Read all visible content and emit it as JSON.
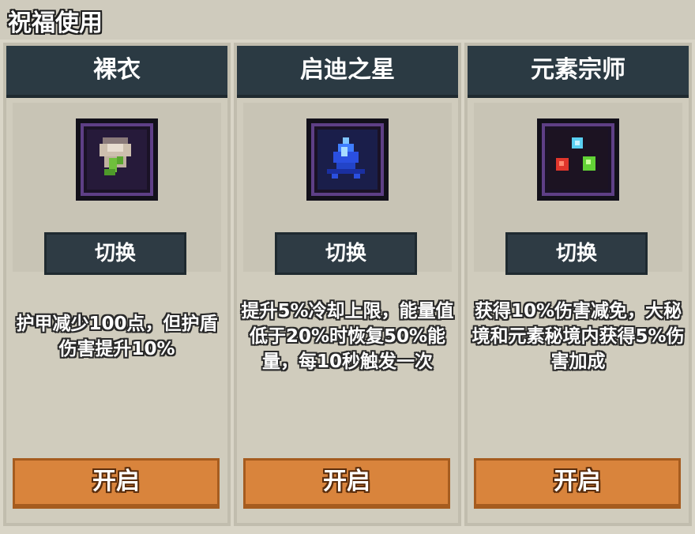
{
  "header": {
    "title": "祝福使用"
  },
  "cards": [
    {
      "title": "裸衣",
      "icon": "bare-clothes-icon",
      "switch_label": "切换",
      "description": "护甲减少100点，但护盾伤害提升10%",
      "open_label": "开启"
    },
    {
      "title": "启迪之星",
      "icon": "star-crystal-icon",
      "switch_label": "切换",
      "description": "提升5%冷却上限，能量值低于20%时恢复50%能量，每10秒触发一次",
      "open_label": "开启"
    },
    {
      "title": "元素宗师",
      "icon": "element-orbs-icon",
      "switch_label": "切换",
      "description": "获得10%伤害减免，大秘境和元素秘境内获得5%伤害加成",
      "open_label": "开启"
    }
  ],
  "colors": {
    "title_bar": "#2b3a43",
    "open_button": "#d9843c",
    "panel": "#d0ccbd"
  }
}
